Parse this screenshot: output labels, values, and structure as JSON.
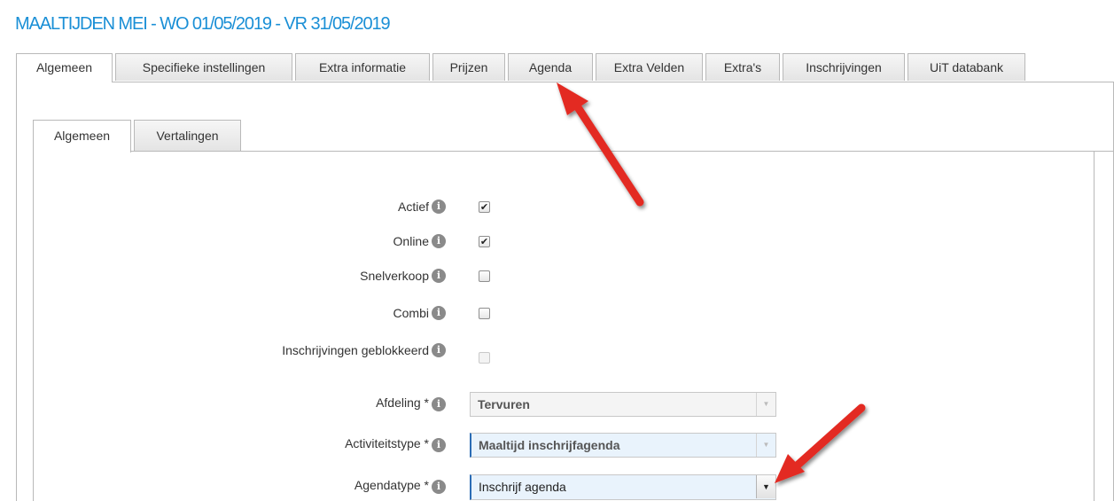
{
  "header": {
    "title": "MAALTIJDEN MEI - WO 01/05/2019 - VR 31/05/2019"
  },
  "main_tabs": [
    {
      "label": "Algemeen",
      "active": true
    },
    {
      "label": "Specifieke instellingen"
    },
    {
      "label": "Extra informatie"
    },
    {
      "label": "Prijzen"
    },
    {
      "label": "Agenda"
    },
    {
      "label": "Extra Velden"
    },
    {
      "label": "Extra's"
    },
    {
      "label": "Inschrijvingen"
    },
    {
      "label": "UiT databank"
    }
  ],
  "sub_tabs": [
    {
      "label": "Algemeen",
      "active": true
    },
    {
      "label": "Vertalingen"
    }
  ],
  "form": {
    "actief": {
      "label": "Actief",
      "checked": true,
      "mark": "✔"
    },
    "online": {
      "label": "Online",
      "checked": true,
      "mark": "✔"
    },
    "snelverkoop": {
      "label": "Snelverkoop",
      "checked": false
    },
    "combi": {
      "label": "Combi",
      "checked": false
    },
    "geblokkeerd": {
      "label": "Inschrijvingen geblokkeerd",
      "checked": false,
      "disabled": true
    },
    "afdeling": {
      "label": "Afdeling *",
      "value": "Tervuren"
    },
    "activiteitstype": {
      "label": "Activiteitstype *",
      "value": "Maaltijd inschrijfagenda"
    },
    "agendatype": {
      "label": "Agendatype *",
      "value": "Inschrijf agenda"
    }
  },
  "icons": {
    "info": "i",
    "dropdown": "▼"
  },
  "colors": {
    "title": "#1a8fd6",
    "annotation_arrow": "#e32b22"
  }
}
